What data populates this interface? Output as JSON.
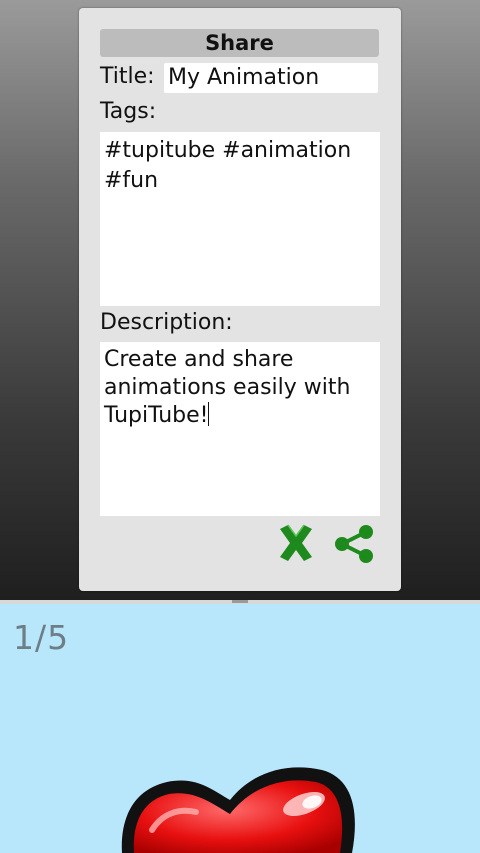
{
  "dialog": {
    "title": "Share",
    "title_label": "Title:",
    "title_value": "My Animation",
    "tags_label": "Tags:",
    "tags_value": "#tupitube #animation #fun",
    "description_label": "Description:",
    "description_value": "Create and share animations easily with TupiTube!",
    "cancel_icon": "cancel-x-icon",
    "share_icon": "share-icon",
    "icon_color": "#1e8a1e"
  },
  "canvas": {
    "frame_counter": "1/5",
    "background_color": "#b8e6fb"
  }
}
